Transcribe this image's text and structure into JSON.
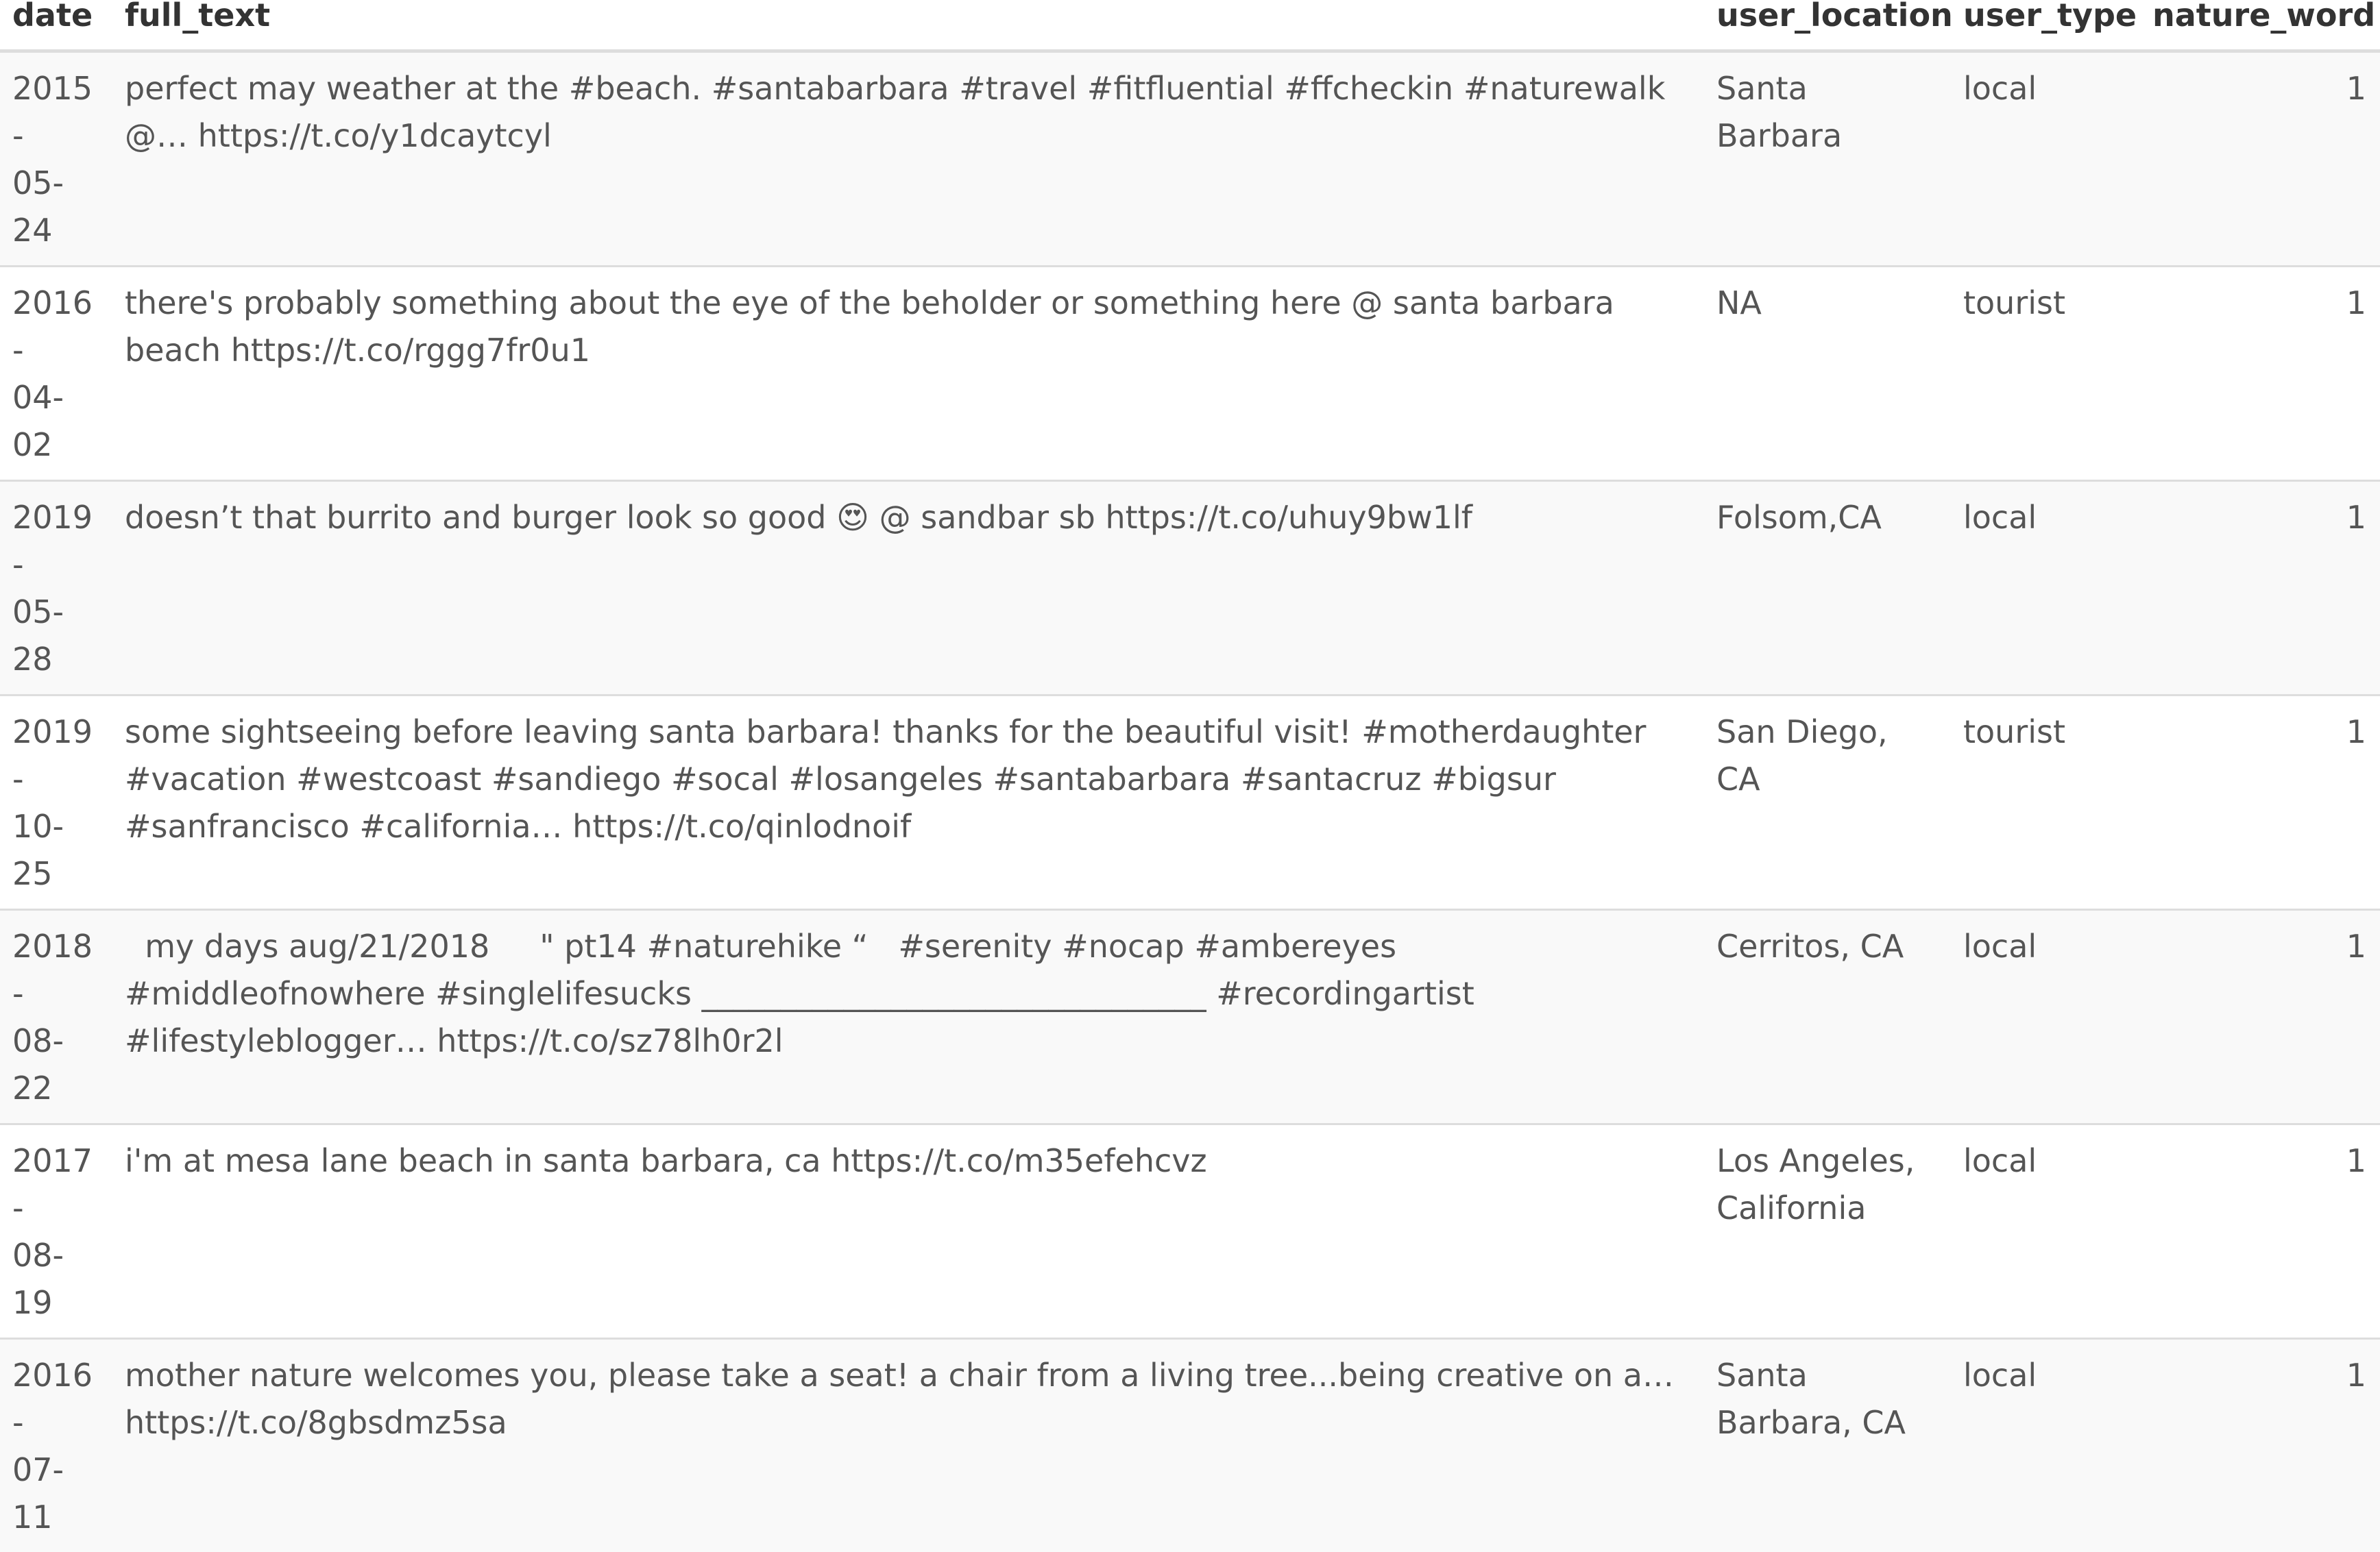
{
  "table": {
    "columns": [
      "date",
      "full_text",
      "user_location",
      "user_type",
      "nature_word"
    ],
    "rows": [
      {
        "date": "2015-\n05-24",
        "full_text": "perfect may weather at the #beach. #santabarbara #travel #fitfluential #ffcheckin #naturewalk @… https://t.co/y1dcaytcyl",
        "user_location": "Santa Barbara",
        "user_type": "local",
        "nature_word": "1"
      },
      {
        "date": "2016-\n04-02",
        "full_text": "there's probably something about the eye of the beholder or something here @ santa barbara beach https://t.co/rggg7fr0u1",
        "user_location": "NA",
        "user_type": "tourist",
        "nature_word": "1"
      },
      {
        "date": "2019-\n05-28",
        "full_text": "doesn’t that burrito and burger look so good 😍 @ sandbar sb https://t.co/uhuy9bw1lf",
        "user_location": "Folsom,CA",
        "user_type": "local",
        "nature_word": "1"
      },
      {
        "date": "2019-\n10-25",
        "full_text": "some sightseeing before leaving santa barbara! thanks for the beautiful visit! #motherdaughter #vacation #westcoast #sandiego #socal #losangeles #santabarbara #santacruz #bigsur #sanfrancisco #california… https://t.co/qinlodnoif",
        "user_location": "San Diego, CA",
        "user_type": "tourist",
        "nature_word": "1"
      },
      {
        "date": "2018-\n08-22",
        "full_text": "  my days aug/21/2018     \" pt14 #naturehike “   #serenity #nocap #ambereyes #middleofnowhere #singlelifesucks ________________________________ #recordingartist #lifestyleblogger… https://t.co/sz78lh0r2l",
        "user_location": "Cerritos, CA",
        "user_type": "local",
        "nature_word": "1"
      },
      {
        "date": "2017-\n08-19",
        "full_text": "i'm at mesa lane beach in santa barbara, ca https://t.co/m35efehcvz",
        "user_location": "Los Angeles, California",
        "user_type": "local",
        "nature_word": "1"
      },
      {
        "date": "2016-\n07-11",
        "full_text": "mother nature welcomes you, please take a seat! a chair from a living tree...being creative on a… https://t.co/8gbsdmz5sa",
        "user_location": "Santa Barbara, CA",
        "user_type": "local",
        "nature_word": "1"
      }
    ]
  }
}
